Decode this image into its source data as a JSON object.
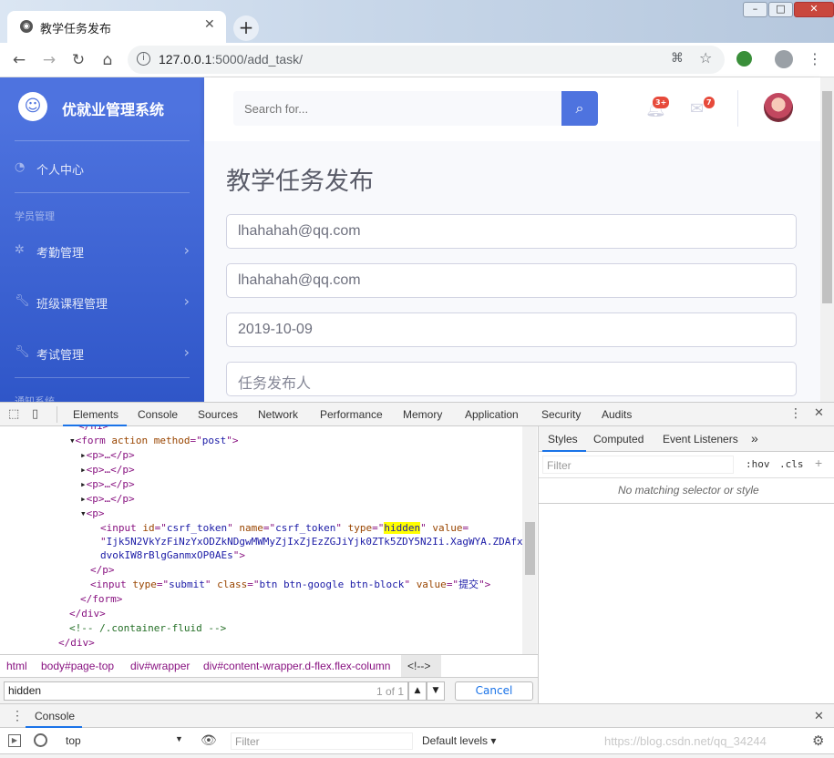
{
  "browser": {
    "tab_title": "教学任务发布",
    "url_host": "127.0.0.1",
    "url_port_path": ":5000/add_task/"
  },
  "sidebar": {
    "brand": "优就业管理系统",
    "items": [
      {
        "label": "个人中心",
        "icon": "dashboard-icon"
      },
      {
        "label": "考勤管理",
        "icon": "gear-icon"
      },
      {
        "label": "班级课程管理",
        "icon": "wrench-icon"
      },
      {
        "label": "考试管理",
        "icon": "wrench-icon"
      }
    ],
    "section_student": "学员管理",
    "section_notice": "通知系统"
  },
  "topbar": {
    "search_placeholder": "Search for...",
    "alerts_badge": "3+",
    "messages_badge": "7"
  },
  "main": {
    "title": "教学任务发布",
    "fields": [
      "lhahahah@qq.com",
      "lhahahah@qq.com",
      "2019-10-09"
    ],
    "field4_placeholder": "任务发布人"
  },
  "devtools": {
    "tabs": [
      "Elements",
      "Console",
      "Sources",
      "Network",
      "Performance",
      "Memory",
      "Application",
      "Security",
      "Audits"
    ],
    "dom": {
      "form_tag": "form",
      "form_attr_action": "action",
      "form_attr_method": "method",
      "form_method_value": "post",
      "p_collapsed": "<p>…</p>",
      "input_id": "csrf_token",
      "input_name": "csrf_token",
      "input_type": "hidden",
      "token_line1": "Ijk5N2VkYzFiNzYxODZkNDgwMWMyZjIxZjEzZGJiYjk0ZTk5ZDY5N2Ii.XagWYA.ZDAfx",
      "token_line2": "dvokIW8rBlgGanmxOP0AEs",
      "submit_class": "btn btn-google btn-block",
      "submit_value": "提交",
      "comment": "<!-- /.container-fluid -->"
    },
    "breadcrumbs": [
      "html",
      "body#page-top",
      "div#wrapper",
      "div#content-wrapper.d-flex.flex-column",
      "<!-->"
    ],
    "find_value": "hidden",
    "find_count": "1 of 1",
    "cancel_label": "Cancel",
    "styles_tabs": [
      "Styles",
      "Computed",
      "Event Listeners"
    ],
    "styles_filter_placeholder": "Filter",
    "hov": ":hov",
    "cls": ".cls",
    "no_match": "No matching selector or style",
    "drawer_tab": "Console",
    "context": "top",
    "console_filter_placeholder": "Filter",
    "levels": "Default levels",
    "watermark": "https://blog.csdn.net/qq_34244"
  }
}
